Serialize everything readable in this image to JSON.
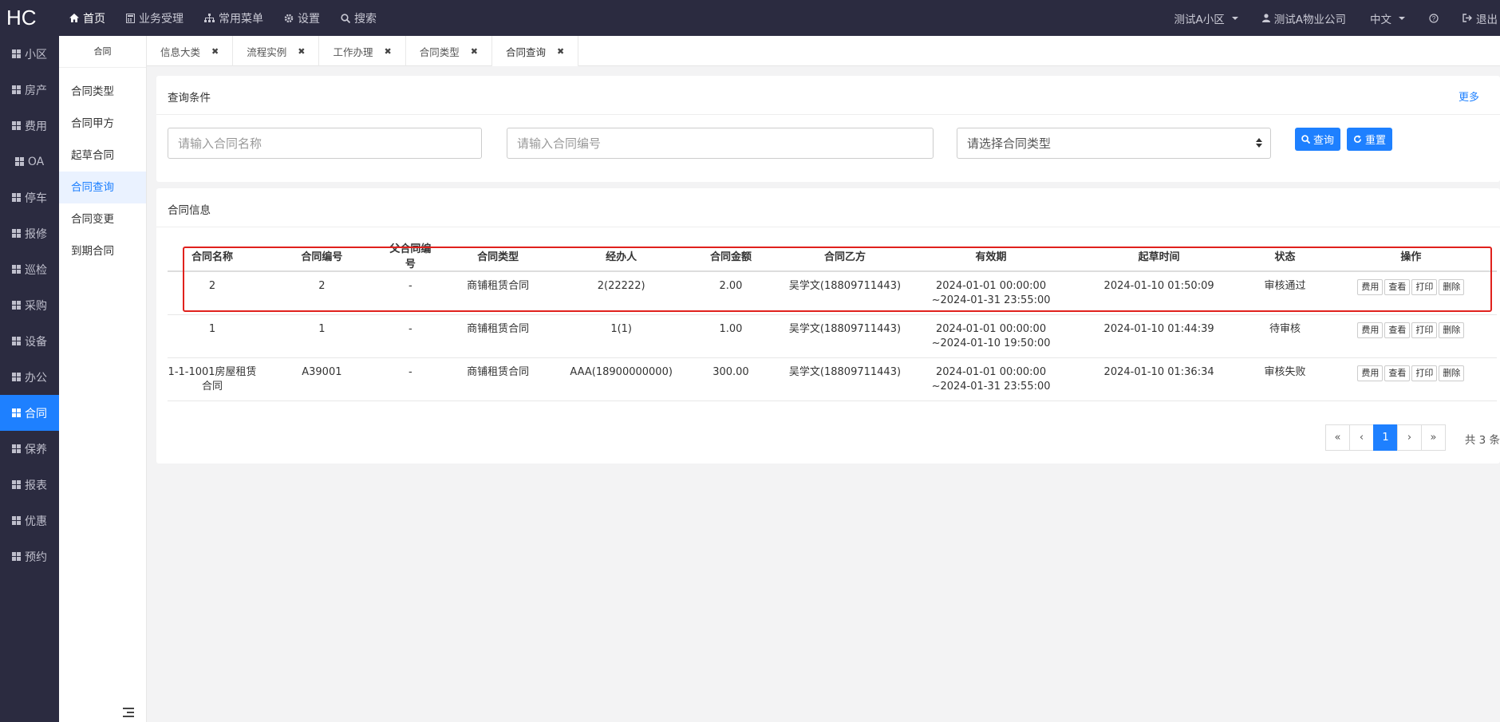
{
  "brand": "HC",
  "topnav": [
    {
      "icon": "home-icon",
      "label": "首页",
      "active": true
    },
    {
      "icon": "calculator-icon",
      "label": "业务受理"
    },
    {
      "icon": "sitemap-icon",
      "label": "常用菜单"
    },
    {
      "icon": "gear-icon",
      "label": "设置"
    },
    {
      "icon": "search-icon",
      "label": "搜索"
    }
  ],
  "topright": {
    "community": "测试A小区",
    "company": "测试A物业公司",
    "language": "中文",
    "help_icon": "question-icon",
    "logout": "退出"
  },
  "leftmenu": [
    "小区",
    "房产",
    "费用",
    "OA",
    "停车",
    "报修",
    "巡检",
    "采购",
    "设备",
    "办公",
    "合同",
    "保养",
    "报表",
    "优惠",
    "预约"
  ],
  "leftmenu_active": "合同",
  "submenu": {
    "title": "合同",
    "items": [
      "合同类型",
      "合同甲方",
      "起草合同",
      "合同查询",
      "合同变更",
      "到期合同"
    ],
    "active": "合同查询"
  },
  "tabs": [
    "信息大类",
    "流程实例",
    "工作办理",
    "合同类型",
    "合同查询"
  ],
  "query": {
    "title": "查询条件",
    "more": "更多",
    "name_placeholder": "请输入合同名称",
    "code_placeholder": "请输入合同编号",
    "type_placeholder": "请选择合同类型",
    "search_label": "查询",
    "reset_label": "重置"
  },
  "table": {
    "title": "合同信息",
    "headers": [
      "合同名称",
      "合同编号",
      "父合同编号",
      "合同类型",
      "经办人",
      "合同金额",
      "合同乙方",
      "有效期",
      "起草时间",
      "状态",
      "操作"
    ],
    "rows": [
      {
        "name": "2",
        "code": "2",
        "parent": "-",
        "type": "商铺租赁合同",
        "handler": "2(22222)",
        "amount": "2.00",
        "party_b": "吴学文(18809711443)",
        "valid_start": "2024-01-01 00:00:00",
        "valid_end": "~2024-01-31 23:55:00",
        "draft_time": "2024-01-10 01:50:09",
        "status": "审核通过"
      },
      {
        "name": "1",
        "code": "1",
        "parent": "-",
        "type": "商铺租赁合同",
        "handler": "1(1)",
        "amount": "1.00",
        "party_b": "吴学文(18809711443)",
        "valid_start": "2024-01-01 00:00:00",
        "valid_end": "~2024-01-10 19:50:00",
        "draft_time": "2024-01-10 01:44:39",
        "status": "待审核"
      },
      {
        "name": "1-1-1001房屋租赁合同",
        "code": "A39001",
        "parent": "-",
        "type": "商铺租赁合同",
        "handler": "AAA(18900000000)",
        "amount": "300.00",
        "party_b": "吴学文(18809711443)",
        "valid_start": "2024-01-01 00:00:00",
        "valid_end": "~2024-01-31 23:55:00",
        "draft_time": "2024-01-10 01:36:34",
        "status": "审核失败"
      }
    ],
    "ops": [
      "费用",
      "查看",
      "打印",
      "删除"
    ]
  },
  "pagination": {
    "first": "«",
    "prev": "‹",
    "current": "1",
    "next": "›",
    "last": "»",
    "total": "共 3 条"
  },
  "colors": {
    "dark": "#2b2b40",
    "primary": "#1e80ff",
    "highlight": "#e0211d"
  }
}
